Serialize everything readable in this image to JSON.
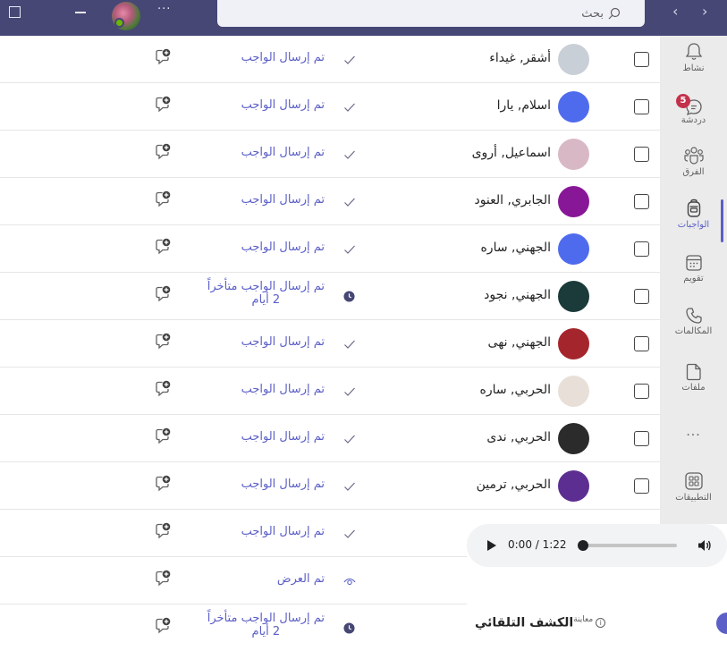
{
  "titlebar": {
    "more_label": "···",
    "search_placeholder": "بحث",
    "nav_back": "‹",
    "nav_forward": "›"
  },
  "rail": {
    "items": [
      {
        "label": "نشاط",
        "icon": "bell-icon"
      },
      {
        "label": "دردشة",
        "icon": "chat-icon",
        "badge": "5"
      },
      {
        "label": "الفرق",
        "icon": "teams-icon"
      },
      {
        "label": "الواجبات",
        "icon": "backpack-icon",
        "active": true
      },
      {
        "label": "تقويم",
        "icon": "calendar-icon"
      },
      {
        "label": "المكالمات",
        "icon": "phone-icon"
      },
      {
        "label": "ملفات",
        "icon": "file-icon"
      },
      {
        "label": "···",
        "icon": "more-icon"
      },
      {
        "label": "التطبيقات",
        "icon": "apps-icon"
      }
    ]
  },
  "rows": [
    {
      "name": "أشقر, غيداء",
      "status": "تم إرسال الواجب",
      "status_line2": "",
      "status_icon": "check-icon",
      "avatar_color": "#c9cfd6"
    },
    {
      "name": "اسلام, يارا",
      "status": "تم إرسال الواجب",
      "status_line2": "",
      "status_icon": "check-icon",
      "avatar_color": "#4f6bed"
    },
    {
      "name": "اسماعيل, أروى",
      "status": "تم إرسال الواجب",
      "status_line2": "",
      "status_icon": "check-icon",
      "avatar_color": "#d9b8c6"
    },
    {
      "name": "الجابري, العنود",
      "status": "تم إرسال الواجب",
      "status_line2": "",
      "status_icon": "check-icon",
      "avatar_color": "#881798"
    },
    {
      "name": "الجهني, ساره",
      "status": "تم إرسال الواجب",
      "status_line2": "",
      "status_icon": "check-icon",
      "avatar_color": "#4f6bed"
    },
    {
      "name": "الجهني, نجود",
      "status": "تم إرسال الواجب متأخراً",
      "status_line2": "2 أيام",
      "status_icon": "clock-icon",
      "avatar_color": "#1b3a3a"
    },
    {
      "name": "الجهني, نهى",
      "status": "تم إرسال الواجب",
      "status_line2": "",
      "status_icon": "check-icon",
      "avatar_color": "#a4262c"
    },
    {
      "name": "الحربي, ساره",
      "status": "تم إرسال الواجب",
      "status_line2": "",
      "status_icon": "check-icon",
      "avatar_color": "#e8e0d8"
    },
    {
      "name": "الحربي, ندى",
      "status": "تم إرسال الواجب",
      "status_line2": "",
      "status_icon": "check-icon",
      "avatar_color": "#2b2b2b"
    },
    {
      "name": "الحربي, ترمين",
      "status": "تم إرسال الواجب",
      "status_line2": "",
      "status_icon": "check-icon",
      "avatar_color": "#5c2e91"
    },
    {
      "name": "",
      "status": "تم إرسال الواجب",
      "status_line2": "",
      "status_icon": "check-icon",
      "avatar_color": ""
    },
    {
      "name": "",
      "status": "تم العرض",
      "status_line2": "",
      "status_icon": "eye-icon",
      "avatar_color": ""
    },
    {
      "name": "",
      "status": "تم إرسال الواجب متأخراً",
      "status_line2": "2 أيام",
      "status_icon": "clock-icon",
      "avatar_color": ""
    }
  ],
  "audio": {
    "time": "0:00 / 1:22",
    "progress": 0
  },
  "feature": {
    "label": "الكشف التلقائي",
    "tag": "معاينة",
    "info": "i"
  },
  "colors": {
    "titlebar": "#464775",
    "accent": "#5b5fc7",
    "rail": "#ebebeb"
  }
}
